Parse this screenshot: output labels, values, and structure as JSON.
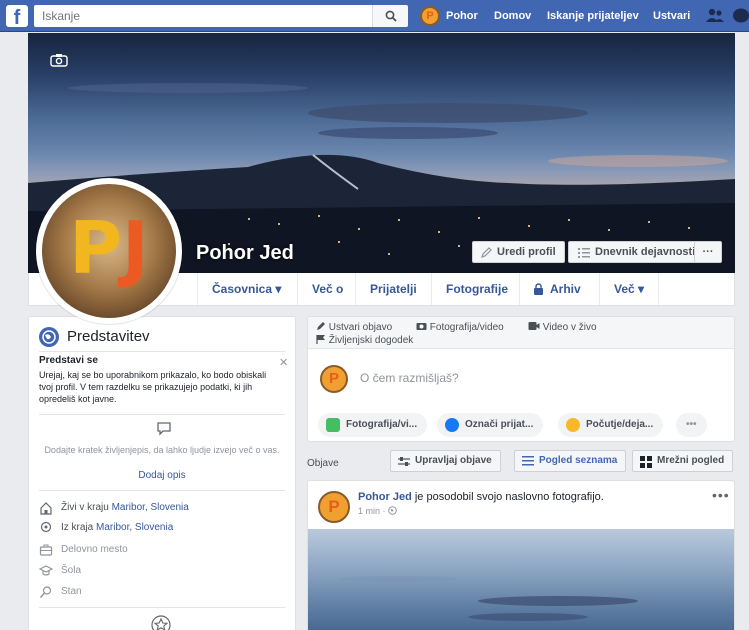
{
  "topbar": {
    "logo": "f",
    "search_placeholder": "Iskanje",
    "profile_name": "Pohor",
    "nav": [
      "Domov",
      "Iskanje prijateljev",
      "Ustvari"
    ]
  },
  "profile": {
    "name": "Pohor Jed",
    "initials": [
      "P",
      "J"
    ],
    "edit_profile": "Uredi profil",
    "activity_log": "Dnevnik dejavnosti",
    "more_dots": "···"
  },
  "tabs": [
    "Časovnica ▾",
    "Več o",
    "Prijatelji",
    "Fotografije",
    "Arhiv",
    "Več ▾"
  ],
  "intro": {
    "title": "Predstavitev",
    "predstavi_title": "Predstavi se",
    "predstavi_text": "Urejaj, kaj se bo uporabnikom prikazalo, ko bodo obiskali tvoj profil. V tem razdelku se prikazujejo podatki, ki jih opredeliš kot javne.",
    "bio_hint": "Dodajte kratek življenjepis, da lahko ljudje izvejo več o vas.",
    "bio_link": "Dodaj opis",
    "lives_prefix": "Živi v kraju ",
    "lives_place": "Maribor, Slovenia",
    "from_prefix": "Iz kraja ",
    "from_place": "Maribor, Slovenia",
    "workplace": "Delovno mesto",
    "school": "Šola",
    "relationship": "Stan"
  },
  "composer": {
    "create_post": "Ustvari objavo",
    "photo_video": "Fotografija/video",
    "live_video": "Video v živo",
    "life_event": "Življenjski dogodek",
    "prompt": "O čem razmišljaš?",
    "chip_photo": "Fotografija/vi...",
    "chip_tag": "Označi prijat...",
    "chip_feeling": "Počutje/deja...",
    "chip_more": "•••"
  },
  "posts_bar": {
    "label": "Objave",
    "manage": "Upravljaj objave",
    "list_view": "Pogled seznama",
    "grid_view": "Mrežni pogled"
  },
  "post": {
    "author": "Pohor Jed",
    "action": " je posodobil svojo naslovno fotografijo.",
    "time": "1 min · ",
    "more": "•••"
  },
  "colors": {
    "brand": "#4267b2",
    "link": "#365899",
    "background": "#e9ebee"
  }
}
